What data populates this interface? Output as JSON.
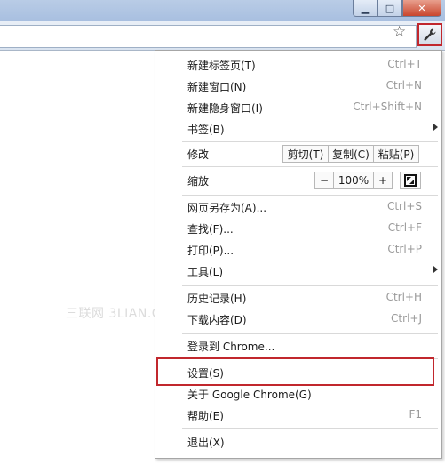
{
  "window": {
    "minimize_icon": "minimize-icon",
    "maximize_icon": "maximize-icon",
    "close_icon": "close-icon"
  },
  "toolbar": {
    "bookmark_icon": "star-icon",
    "menu_icon": "wrench-icon"
  },
  "watermark": "三联网 3LIAN.COM",
  "menu": {
    "new_tab": {
      "label": "新建标签页(T)",
      "shortcut": "Ctrl+T"
    },
    "new_window": {
      "label": "新建窗口(N)",
      "shortcut": "Ctrl+N"
    },
    "new_incognito": {
      "label": "新建隐身窗口(I)",
      "shortcut": "Ctrl+Shift+N"
    },
    "bookmarks": {
      "label": "书签(B)"
    },
    "edit": {
      "label": "修改",
      "cut": "剪切(T)",
      "copy": "复制(C)",
      "paste": "粘贴(P)"
    },
    "zoom": {
      "label": "缩放",
      "minus": "−",
      "value": "100%",
      "plus": "+"
    },
    "save_as": {
      "label": "网页另存为(A)...",
      "shortcut": "Ctrl+S"
    },
    "find": {
      "label": "查找(F)...",
      "shortcut": "Ctrl+F"
    },
    "print": {
      "label": "打印(P)...",
      "shortcut": "Ctrl+P"
    },
    "tools": {
      "label": "工具(L)"
    },
    "history": {
      "label": "历史记录(H)",
      "shortcut": "Ctrl+H"
    },
    "downloads": {
      "label": "下载内容(D)",
      "shortcut": "Ctrl+J"
    },
    "signin": {
      "label": "登录到 Chrome..."
    },
    "settings": {
      "label": "设置(S)"
    },
    "about": {
      "label": "关于 Google Chrome(G)"
    },
    "help": {
      "label": "帮助(E)",
      "shortcut": "F1"
    },
    "exit": {
      "label": "退出(X)"
    }
  },
  "colors": {
    "highlight_border": "#c1272d"
  }
}
